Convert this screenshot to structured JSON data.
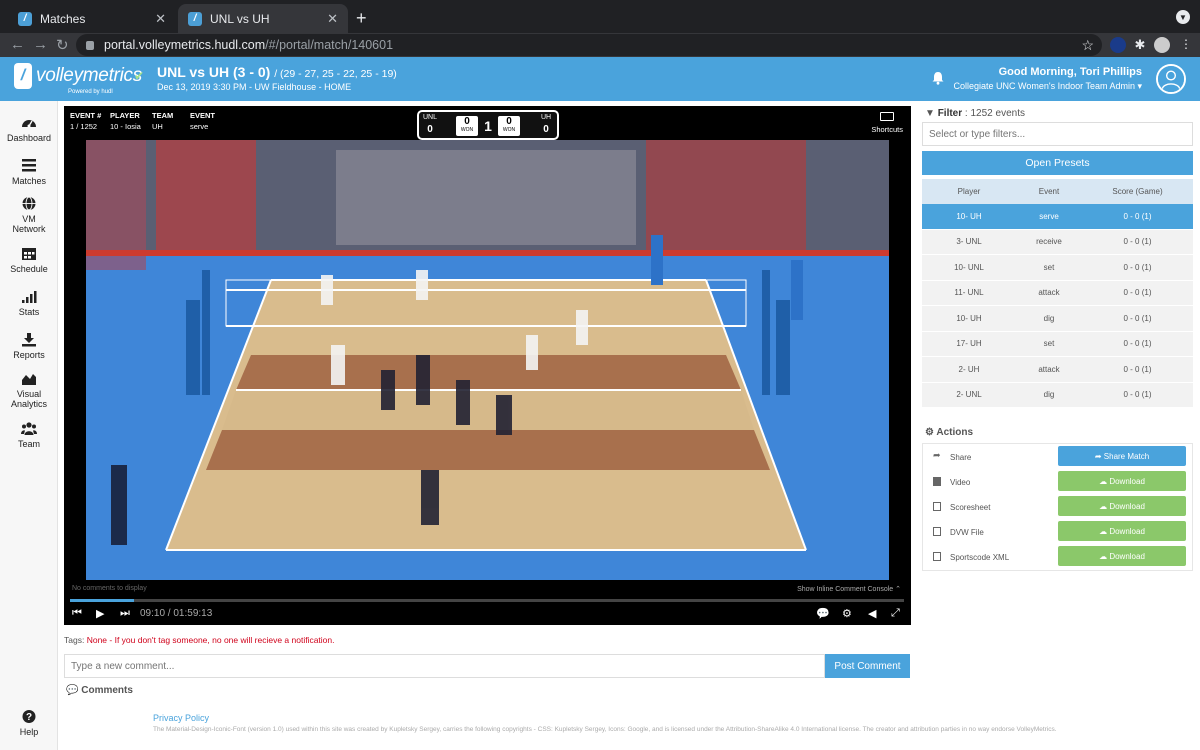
{
  "browser": {
    "tabs": [
      {
        "label": "Matches",
        "active": false
      },
      {
        "label": "UNL vs UH",
        "active": true
      }
    ],
    "url_host": "portal.volleymetrics.hudl.com",
    "url_path": "/#/portal/match/140601"
  },
  "header": {
    "logo_text": "volleymetrics",
    "logo_sub": "Powered by hudl",
    "match_title": "UNL vs UH (3 - 0)",
    "match_scores": "/ (29 - 27, 25 - 22, 25 - 19)",
    "match_details": "Dec 13, 2019 3:30 PM - UW Fieldhouse - HOME",
    "greeting": "Good Morning, Tori Phillips",
    "role": "Collegiate UNC Women's Indoor Team Admin"
  },
  "sidebar": {
    "items": [
      {
        "label": "Dashboard",
        "icon": "dashboard-icon"
      },
      {
        "label": "Matches",
        "icon": "list-icon"
      },
      {
        "label": "VM Network",
        "icon": "globe-icon"
      },
      {
        "label": "Schedule",
        "icon": "calendar-icon"
      },
      {
        "label": "Stats",
        "icon": "bar-chart-icon"
      },
      {
        "label": "Reports",
        "icon": "download-icon"
      },
      {
        "label": "Visual Analytics",
        "icon": "area-chart-icon"
      },
      {
        "label": "Team",
        "icon": "team-icon"
      }
    ],
    "help": "Help"
  },
  "video": {
    "event_num_h": "EVENT #",
    "event_num": "1 / 1252",
    "player_h": "PLAYER",
    "player": "10 - Iosia",
    "team_h": "TEAM",
    "team": "UH",
    "event_h": "EVENT",
    "event": "serve",
    "score": {
      "left_team": "UNL",
      "left_sets": "0",
      "left_points": "0",
      "left_won": "WON",
      "center": "1",
      "right_points": "0",
      "right_won": "WON",
      "right_team": "UH",
      "right_sets": "0"
    },
    "shortcuts": "Shortcuts",
    "no_comments": "No comments to display",
    "inline_console": "Show Inline Comment Console",
    "time": "09:10 / 01:59:13",
    "progress_fraction": 0.077
  },
  "comments": {
    "tags_label": "Tags:",
    "tags_value": "None - If you don't tag someone, no one will recieve a notification.",
    "placeholder": "Type a new comment...",
    "post_button": "Post Comment",
    "heading": "Comments"
  },
  "footer": {
    "privacy": "Privacy Policy",
    "legal": "The Material-Design-Iconic-Font (version 1.0) used within this site was created by Kupletsky Sergey, carries the following copyrights - CSS: Kupletsky Sergey, Icons: Google, and is licensed under the Attribution-ShareAlike 4.0 International license. The creator and attribution parties in no way endorse VolleyMetrics."
  },
  "filter": {
    "label": "Filter",
    "count": "1252 events",
    "placeholder": "Select or type filters...",
    "presets_button": "Open Presets",
    "columns": [
      "Player",
      "Event",
      "Score (Game)"
    ],
    "rows": [
      {
        "player": "10- UH",
        "event": "serve",
        "score": "0 - 0 (1)",
        "selected": true
      },
      {
        "player": "3- UNL",
        "event": "receive",
        "score": "0 - 0 (1)"
      },
      {
        "player": "10- UNL",
        "event": "set",
        "score": "0 - 0 (1)"
      },
      {
        "player": "11- UNL",
        "event": "attack",
        "score": "0 - 0 (1)"
      },
      {
        "player": "10- UH",
        "event": "dig",
        "score": "0 - 0 (1)"
      },
      {
        "player": "17- UH",
        "event": "set",
        "score": "0 - 0 (1)"
      },
      {
        "player": "2- UH",
        "event": "attack",
        "score": "0 - 0 (1)"
      },
      {
        "player": "2- UNL",
        "event": "dig",
        "score": "0 - 0 (1)"
      }
    ]
  },
  "actions": {
    "heading": "Actions",
    "rows": [
      {
        "label": "Share",
        "button": "Share Match",
        "icon": "share-icon"
      },
      {
        "label": "Video",
        "button": "Download",
        "icon": "video-icon"
      },
      {
        "label": "Scoresheet",
        "button": "Download",
        "icon": "file-icon"
      },
      {
        "label": "DVW File",
        "button": "Download",
        "icon": "file-icon"
      },
      {
        "label": "Sportscode XML",
        "button": "Download",
        "icon": "file-icon"
      }
    ]
  },
  "colors": {
    "brand_blue": "#4aa3dc",
    "download_green": "#8bc86a",
    "warning_red": "#d0021b"
  }
}
